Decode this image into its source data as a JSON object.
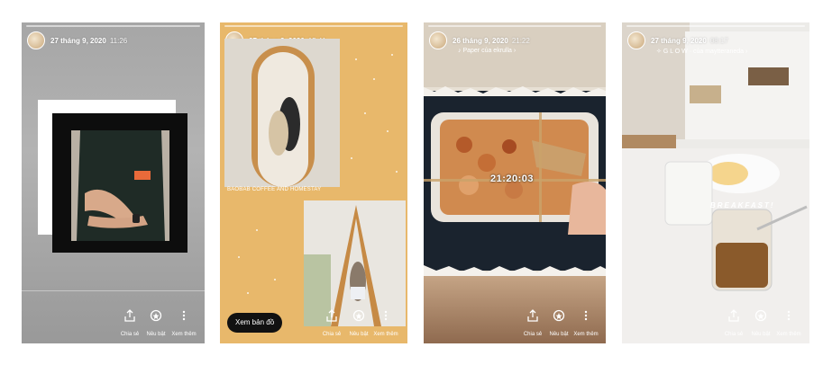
{
  "stories": [
    {
      "date": "27 tháng 9, 2020",
      "time": "11:26",
      "subtitle": ""
    },
    {
      "date": "27 tháng 9, 2020",
      "time": "15:41",
      "subtitle": "",
      "location_tag": "BAOBAB COFFEE AND HOMESTAY",
      "map_button": "Xem bản đồ"
    },
    {
      "date": "26 tháng 9, 2020",
      "time": "21:22",
      "subtitle": "Paper của ekrulla",
      "timer_text": "21:20:03"
    },
    {
      "date": "27 tháng 9, 2020",
      "time": "08:17",
      "subtitle": "G L O W · của maytteraneda",
      "sticker_text": "BREAKFAST!"
    }
  ],
  "actions": {
    "share": "Chia sẻ",
    "highlight": "Nêu bật",
    "more": "Xem thêm"
  },
  "icons": [
    "share-icon",
    "highlight-icon",
    "more-icon"
  ]
}
